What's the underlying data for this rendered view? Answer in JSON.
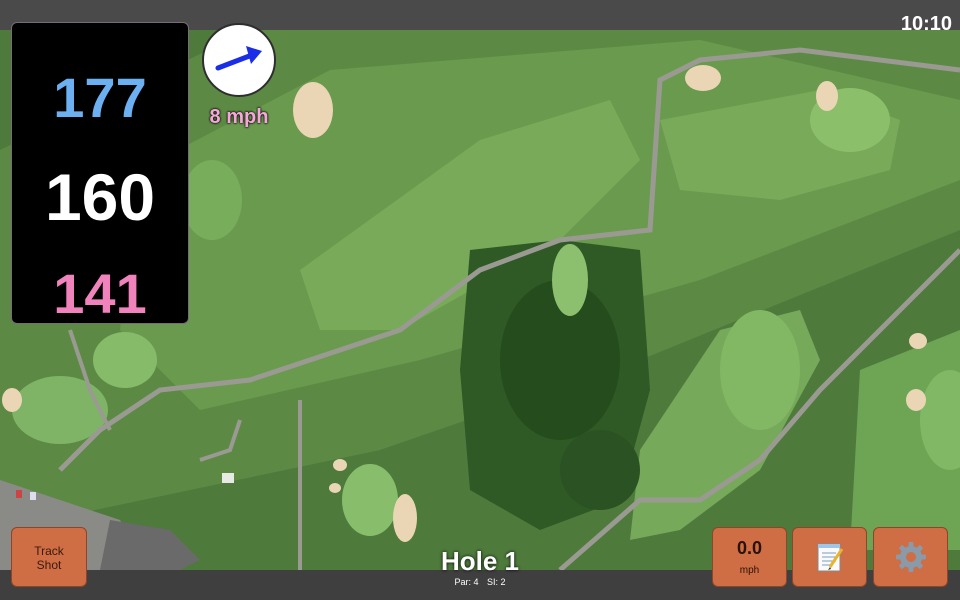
{
  "status_bar": {
    "time": "10:10"
  },
  "distances": {
    "back": "177",
    "middle": "160",
    "front": "141"
  },
  "wind": {
    "speed_label": "8 mph"
  },
  "hole": {
    "title": "Hole 1",
    "par_label": "Par: 4",
    "si_label": "SI: 2"
  },
  "buttons": {
    "track_shot_line1": "Track",
    "track_shot_line2": "Shot",
    "speed_value": "0.0",
    "speed_unit": "mph",
    "notes_icon": "notepad-icon",
    "settings_icon": "gear-icon"
  },
  "colors": {
    "back_distance": "#6db0f2",
    "middle_distance": "#ffffff",
    "front_distance": "#f082bc",
    "button": "#cf6d45",
    "wind_arrow": "#1a2ee8",
    "accent_border": "#b06aa0"
  }
}
